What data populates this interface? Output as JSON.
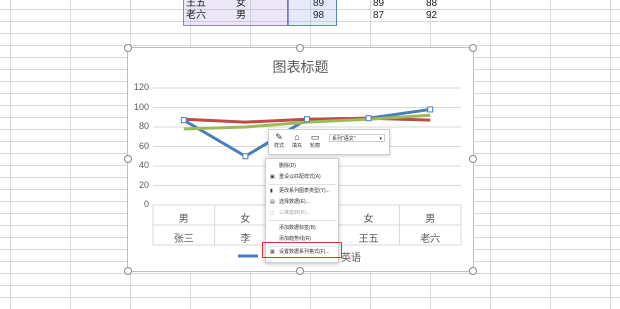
{
  "sheet": {
    "rows": [
      {
        "name": "王五",
        "gender": "女",
        "c3": "89",
        "c4": "89",
        "c5": "88"
      },
      {
        "name": "老六",
        "gender": "男",
        "c3": "98",
        "c4": "87",
        "c5": "92"
      }
    ]
  },
  "chart": {
    "title": "图表标题",
    "legend_visible": "英语",
    "colors": {
      "blue": "#4a7ebb",
      "red": "#be4b48",
      "green": "#9bbb59"
    },
    "x_labels": [
      {
        "gender": "男",
        "name": "张三"
      },
      {
        "gender": "女",
        "name": "李"
      },
      {
        "gender": "",
        "name": ""
      },
      {
        "gender": "女",
        "name": "王五"
      },
      {
        "gender": "男",
        "name": "老六"
      }
    ]
  },
  "chart_data": {
    "type": "line",
    "title": "图表标题",
    "categories": [
      "男 张三",
      "女 李四",
      "",
      "女 王五",
      "男 老六"
    ],
    "ylim": [
      0,
      120
    ],
    "yticks": [
      "0",
      "20",
      "40",
      "60",
      "80",
      "100",
      "120"
    ],
    "series": [
      {
        "color": "#4a7ebb",
        "values": [
          87,
          50,
          88,
          89,
          98
        ]
      },
      {
        "color": "#be4b48",
        "values": [
          88,
          85,
          88,
          89,
          87
        ]
      },
      {
        "name": "英语",
        "color": "#9bbb59",
        "values": [
          78,
          80,
          85,
          88,
          92
        ]
      }
    ]
  },
  "toolbar": {
    "style_label": "样式",
    "fill_label": "填充",
    "outline_label": "轮廓",
    "series_dropdown": "系列\"语文\""
  },
  "context_menu": {
    "items": [
      {
        "icon": "delete-icon",
        "label": "删除(D)",
        "disabled": false
      },
      {
        "icon": "reset-icon",
        "label": "重设以匹配样式(A)",
        "disabled": false
      },
      {
        "icon": "chart-type-icon",
        "label": "更改系列图表类型(Y)...",
        "disabled": false
      },
      {
        "icon": "select-data-icon",
        "label": "选择数据(E)...",
        "disabled": false
      },
      {
        "icon": "rotate-icon",
        "label": "三维旋转(R)...",
        "disabled": true
      },
      {
        "icon": "",
        "label": "添加数据标签(B)",
        "disabled": false
      },
      {
        "icon": "",
        "label": "添加趋势线(R)",
        "disabled": false
      },
      {
        "icon": "format-icon",
        "label": "设置数据系列格式(F)...",
        "disabled": false
      }
    ]
  }
}
